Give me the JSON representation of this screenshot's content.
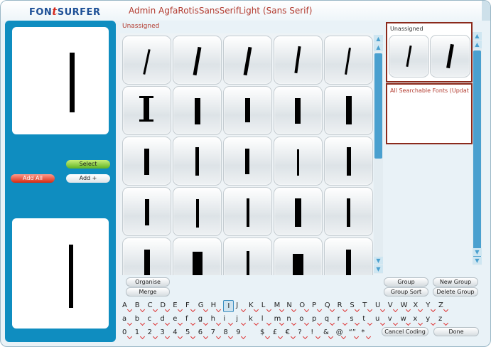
{
  "header": {
    "logo_left": "FON",
    "logo_mid": "t",
    "logo_right": "SURFER",
    "admin": "Admin",
    "font_name": "AgfaRotisSansSerifLight (Sans Serif)"
  },
  "left_panel": {
    "select_label": "Select",
    "add_all_label": "Add All",
    "add_plus_label": "Add +"
  },
  "main": {
    "unassigned_label": "Unassigned"
  },
  "right_panel": {
    "unassigned_title": "Unassigned",
    "search_list_title": "All Searchable Fonts (Updat"
  },
  "buttons": {
    "organise": "Organise",
    "merge": "Merge",
    "group": "Group",
    "group_sort": "Group Sort",
    "new_group": "New Group",
    "delete_group": "Delete Group",
    "cancel_coding": "Cancel Coding",
    "done": "Done"
  },
  "keyboard": {
    "row1": [
      "A",
      "B",
      "C",
      "D",
      "E",
      "F",
      "G",
      "H",
      "I",
      "J",
      "K",
      "L",
      "M",
      "N",
      "O",
      "P",
      "Q",
      "R",
      "S",
      "T",
      "U",
      "V",
      "W",
      "X",
      "Y",
      "Z"
    ],
    "row2": [
      "a",
      "b",
      "c",
      "d",
      "e",
      "f",
      "g",
      "h",
      "i",
      "j",
      "k",
      "l",
      "m",
      "n",
      "o",
      "p",
      "q",
      "r",
      "s",
      "t",
      "u",
      "v",
      "w",
      "x",
      "y",
      "z"
    ],
    "row3_digits": [
      "0",
      "1",
      "2",
      "3",
      "4",
      "5",
      "6",
      "7",
      "8",
      "9"
    ],
    "row3_symbols": [
      "$",
      "£",
      "€",
      "?",
      "!",
      "&",
      "@",
      "“”",
      "*"
    ],
    "selected_key": "I"
  },
  "icons": {
    "scroll_up": "triangle-up-icon",
    "scroll_down": "triangle-down-icon"
  },
  "colors": {
    "brand_blue": "#1d4f96",
    "accent_red": "#b23a2e",
    "panel_blue": "#0f8dc0"
  }
}
